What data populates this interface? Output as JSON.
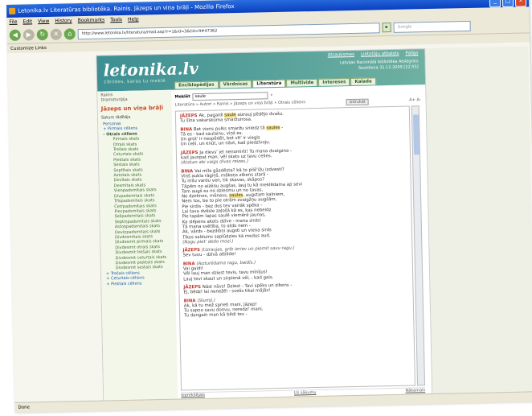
{
  "window": {
    "title": "Letonika.lv Literatūras bibliotēka. Rainis. Jāzeps un viņa brāļi - Mozilla Firefox"
  },
  "menu": [
    "File",
    "Edit",
    "View",
    "History",
    "Bookmarks",
    "Tools",
    "Help"
  ],
  "browser": {
    "url": "http://www.letonika.lv/literatura/read.asp?r=1&id=3&tid=9#47362",
    "search_placeholder": "Google",
    "go_label": "▸",
    "bookmarks_item": "Customize Links"
  },
  "site": {
    "logo": "letonika.lv",
    "tagline": "zibildes, karas tu meklē",
    "toplinks": [
      "Atsauksmes",
      "Lietotāju atbalsts",
      "Palīgs"
    ],
    "libinfo_line1": "Latvijas Nacionālā bibliotēka  Atslēgties",
    "libinfo_line2": "Sestdiena  31.12.2009 [22:55]",
    "tabs": [
      "Enciklopēdijas",
      "Vārdnīcas",
      "Literatūra",
      "Multivide",
      "Intereses",
      "Kalade"
    ],
    "active_tab": "Literatūra",
    "left": {
      "crumb": "Rainis\nDramaturģija",
      "work_title": "Jāzeps un viņa brāļi",
      "section_title": "Saturs rādītājs",
      "nav": [
        {
          "t": "Personas",
          "c": ""
        },
        {
          "t": "+ Pirmais cēliens",
          "c": ""
        },
        {
          "t": "- Otrais cēliens",
          "c": "bold"
        },
        {
          "t": "Pirmais skats",
          "c": "sub"
        },
        {
          "t": "Otrais skats",
          "c": "sub"
        },
        {
          "t": "Trešais skats",
          "c": "sub"
        },
        {
          "t": "Ceturtais skats",
          "c": "sub"
        },
        {
          "t": "Piektais skats",
          "c": "sub"
        },
        {
          "t": "Sestais skats",
          "c": "sub"
        },
        {
          "t": "Septītais skats",
          "c": "sub"
        },
        {
          "t": "Astotais skats",
          "c": "sub"
        },
        {
          "t": "Devītais skats",
          "c": "sub"
        },
        {
          "t": "Desmitais skats",
          "c": "sub"
        },
        {
          "t": "Vienpadsmitais skats",
          "c": "sub"
        },
        {
          "t": "Divpadsmitais skats",
          "c": "sub"
        },
        {
          "t": "Trīspadsmitais skats",
          "c": "sub"
        },
        {
          "t": "Četrpadsmitais skats",
          "c": "sub"
        },
        {
          "t": "Piecpadsmitais skats",
          "c": "sub"
        },
        {
          "t": "Sešpadsmitais skats",
          "c": "sub"
        },
        {
          "t": "Septiņpadsmitais skats",
          "c": "sub"
        },
        {
          "t": "Astoņpadsmitais skats",
          "c": "sub"
        },
        {
          "t": "Deviņpadsmitais skats",
          "c": "sub"
        },
        {
          "t": "Divdesmitais skats",
          "c": "sub"
        },
        {
          "t": "Divdesmit pirmais skats",
          "c": "sub"
        },
        {
          "t": "Divdesmit otrais skats",
          "c": "sub"
        },
        {
          "t": "Divdesmit trešais skats",
          "c": "sub"
        },
        {
          "t": "Divdesmit ceturtais skats",
          "c": "sub"
        },
        {
          "t": "Divdesmit piektais skats",
          "c": "sub"
        },
        {
          "t": "Divdesmit sestais skats",
          "c": "sub"
        },
        {
          "t": "+ Trešais cēliens",
          "c": ""
        },
        {
          "t": "+ Ceturtais cēliens",
          "c": ""
        },
        {
          "t": "+ Piektais cēliens",
          "c": ""
        }
      ]
    },
    "main": {
      "search_label": "Meklēt",
      "search_value": "saule",
      "crumb": "Literatūra » Autori » Rainis » Jāzeps un viņa brāļi » Otrais cēliens",
      "button": "Izdrukāt",
      "font_buttons": [
        "A+",
        "A-"
      ],
      "paragraphs": [
        [
          {
            "k": "spk",
            "t": "JĀZEPS "
          },
          {
            "k": "",
            "t": "Ak, pagaidi "
          },
          {
            "k": "hl",
            "t": "saule"
          },
          {
            "k": "",
            "t": " aizrauj pēdējo dvašu."
          },
          {
            "k": "br"
          },
          {
            "k": "",
            "t": "Tu šīna vakarskūma smaržuirosa."
          }
        ],
        [
          {
            "k": "spk",
            "t": "BINA "
          },
          {
            "k": "",
            "t": "Bet viens pulks smaržu sniedz tā "
          },
          {
            "k": "hl",
            "t": "saules"
          },
          {
            "k": "",
            "t": " -"
          },
          {
            "k": "br"
          },
          {
            "k": "",
            "t": "Tā es - kad saulainu, viņš es."
          },
          {
            "k": "br"
          },
          {
            "k": "",
            "t": "Un grūt' ir nespēdēt, bet vīt' ir viegls"
          },
          {
            "k": "br"
          },
          {
            "k": "",
            "t": "Un ceļš, un knūt, un nāvt, kad piedzīvoju."
          }
        ],
        [
          {
            "k": "spk",
            "t": "JĀZEPS "
          },
          {
            "k": "",
            "t": "Ja dievs' jel nenomirti! Tu mana dvaigzna -"
          },
          {
            "k": "br"
          },
          {
            "k": "",
            "t": "kad jaunpat man, vēl skats uz tavu celies."
          },
          {
            "k": "br"
          },
          {
            "k": "stage",
            "t": "(Atskan abi vaigs divas reizes.)"
          }
        ],
        [
          {
            "k": "spk",
            "t": "BINA "
          },
          {
            "k": "",
            "t": "Vai mīla gāzdēsta? kā to pilē'ižu izdvesti?"
          },
          {
            "k": "br"
          },
          {
            "k": "",
            "t": "Viņš aukla rāgiņš, mākeņs zibens starā -"
          },
          {
            "k": "br"
          },
          {
            "k": "",
            "t": "Tu mīlu vardu ven, tik skavas, skāpos?"
          },
          {
            "k": "br"
          },
          {
            "k": "",
            "t": "Tāpēm no aizēņu augšas, ļauj tu kā meklēdama ap sevi"
          },
          {
            "k": "br"
          },
          {
            "k": "",
            "t": "Tam augš es no dziesmu un no tavas,"
          },
          {
            "k": "br"
          },
          {
            "k": "",
            "t": "No dzelmes, mēness, "
          },
          {
            "k": "hl",
            "t": "saules"
          },
          {
            "k": "",
            "t": ", augstam kalniem,"
          },
          {
            "k": "br"
          },
          {
            "k": "",
            "t": "Nem tos, be to pie otrām zvaigžņu augšām,"
          },
          {
            "k": "br"
          },
          {
            "k": "",
            "t": "Pie sirdis - bez dos tev vairāk spēka -"
          },
          {
            "k": "br"
          },
          {
            "k": "",
            "t": "Lai tava dvēsle zaļošā kā es, kas nebeidz"
          },
          {
            "k": "br"
          },
          {
            "k": "",
            "t": "Pie tapām lapas saulē viemērē jaunas,"
          },
          {
            "k": "br"
          },
          {
            "k": "",
            "t": "Ka slēpens akots dzīve - mana sirds!"
          },
          {
            "k": "br"
          },
          {
            "k": "",
            "t": "Tā mana svētība, to atdo nem -"
          },
          {
            "k": "br"
          },
          {
            "k": "",
            "t": "Ak, vārds - bezdibņi augsti un viena sirds"
          },
          {
            "k": "br"
          },
          {
            "k": "",
            "t": "Tikos saldums saplūdzies kā medus aud."
          },
          {
            "k": "br"
          },
          {
            "k": "stage",
            "t": "(Nagu piet' dedo mozi.)"
          }
        ],
        [
          {
            "k": "spk",
            "t": "JĀZEPS "
          },
          {
            "k": "stage",
            "t": "(Uzraujas, grib ieriev un piemit savu ragu.)"
          },
          {
            "k": "br"
          },
          {
            "k": "",
            "t": "Sev tuvu - dzīvā atbilde!"
          }
        ],
        [
          {
            "k": "spk",
            "t": "BINA "
          },
          {
            "k": "stage",
            "t": "(Aizturēdama ragu, baidīs.)"
          },
          {
            "k": "br"
          },
          {
            "k": "",
            "t": "Vai gaidi!"
          },
          {
            "k": "br"
          },
          {
            "k": "",
            "t": "Vēl lauj man dziest tevis, tavu mīnījus!"
          },
          {
            "k": "br"
          },
          {
            "k": "",
            "t": "Lauj tevi skaut un sirpienā vēl, - kad gais."
          }
        ],
        [
          {
            "k": "spk",
            "t": "JĀZEPS "
          },
          {
            "k": "",
            "t": "Nāst nāvs! Dziest - Tavi spēks un zibens -"
          },
          {
            "k": "br"
          },
          {
            "k": "",
            "t": "Ej, bēdz! lai nenežēl - svešs tikai mājās!"
          }
        ],
        [
          {
            "k": "spk",
            "t": "BINA "
          },
          {
            "k": "stage",
            "t": "(Slumji.)"
          },
          {
            "k": "br"
          },
          {
            "k": "",
            "t": "Ak, kā tu mež sprieti mani, Jāzep!"
          },
          {
            "k": "br"
          },
          {
            "k": "",
            "t": "Tu sapņo savu donvu, neredzi' mani,"
          },
          {
            "k": "br"
          },
          {
            "k": "",
            "t": "Tu dangain man kā bēdi tev -"
          }
        ]
      ],
      "bottom_left": "Ieprekšējais",
      "bottom_center": "Uz sākumu",
      "bottom_right": "Nākamais"
    }
  },
  "status": "Done"
}
